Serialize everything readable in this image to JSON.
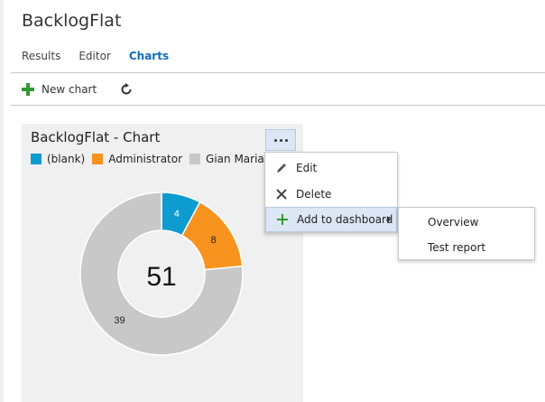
{
  "page": {
    "title": "BacklogFlat"
  },
  "tabs": [
    {
      "label": "Results",
      "active": false
    },
    {
      "label": "Editor",
      "active": false
    },
    {
      "label": "Charts",
      "active": true
    }
  ],
  "toolbar": {
    "new_chart_label": "New chart",
    "new_chart_icon": "plus-icon",
    "refresh_icon": "refresh-icon"
  },
  "card": {
    "title": "BacklogFlat - Chart",
    "more_icon": "ellipsis-icon",
    "legend": [
      {
        "label": "(blank)",
        "color": "#0e9bd0"
      },
      {
        "label": "Administrator",
        "color": "#f7931e"
      },
      {
        "label": "Gian Maria ...",
        "color": "#c8c8c8"
      }
    ]
  },
  "chart_data": {
    "type": "pie",
    "donut": true,
    "center_label": "51",
    "slices": [
      {
        "label": "(blank)",
        "value": 4,
        "color": "#0e9bd0"
      },
      {
        "label": "Administrator",
        "value": 8,
        "color": "#f7931e"
      },
      {
        "label": "Gian Maria ...",
        "value": 39,
        "color": "#c8c8c8"
      }
    ]
  },
  "menu": {
    "items": [
      {
        "label": "Edit",
        "icon": "pencil-icon"
      },
      {
        "label": "Delete",
        "icon": "x-icon"
      },
      {
        "label": "Add to dashboard",
        "icon": "plus-icon",
        "has_submenu": true
      }
    ]
  },
  "submenu": {
    "items": [
      {
        "label": "Overview"
      },
      {
        "label": "Test report"
      }
    ]
  }
}
